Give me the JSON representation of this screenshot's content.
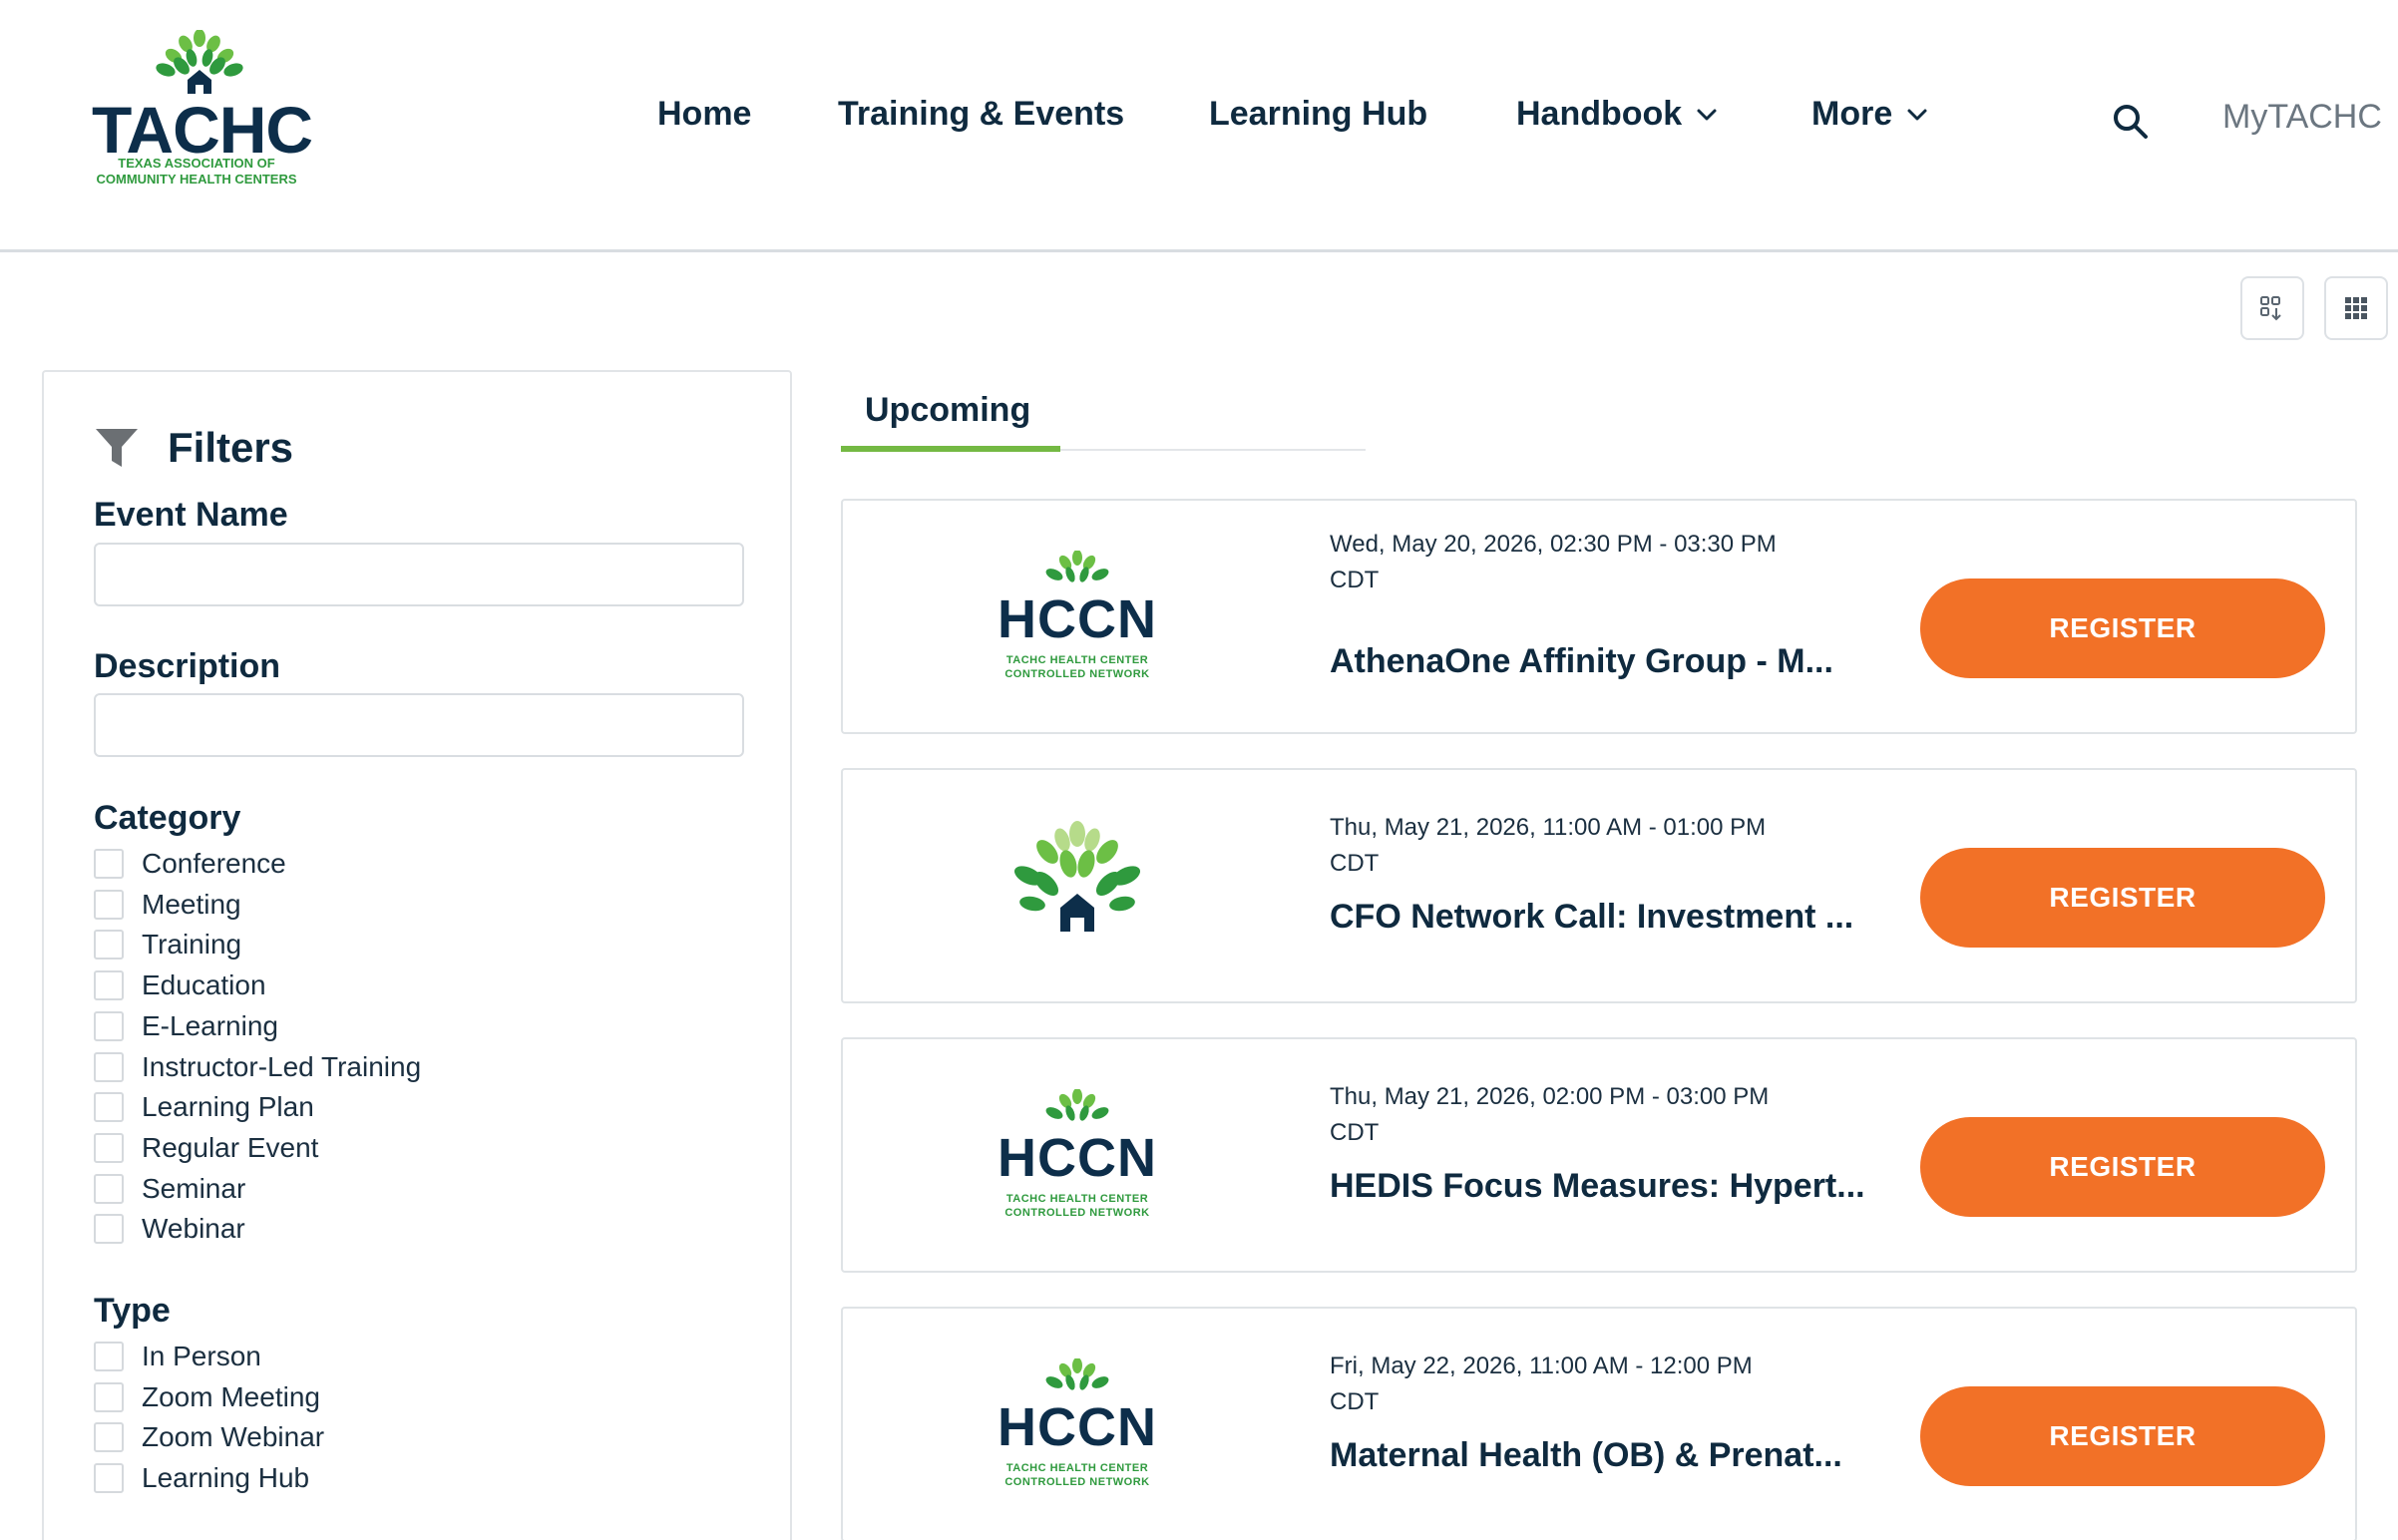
{
  "brand": {
    "name": "TACHC",
    "subtitle_line1": "TEXAS ASSOCIATION OF",
    "subtitle_line2": "COMMUNITY HEALTH CENTERS"
  },
  "nav": {
    "items": [
      {
        "label": "Home"
      },
      {
        "label": "Training & Events"
      },
      {
        "label": "Learning Hub"
      },
      {
        "label": "Handbook"
      },
      {
        "label": "More"
      }
    ],
    "account_label": "MyTACHC"
  },
  "filters": {
    "title": "Filters",
    "event_name_label": "Event Name",
    "description_label": "Description",
    "category_label": "Category",
    "categories": [
      "Conference",
      "Meeting",
      "Training",
      "Education",
      "E-Learning",
      "Instructor-Led Training",
      "Learning Plan",
      "Regular Event",
      "Seminar",
      "Webinar"
    ],
    "type_label": "Type",
    "types": [
      "In Person",
      "Zoom Meeting",
      "Zoom Webinar",
      "Learning Hub"
    ]
  },
  "tabs": {
    "upcoming": "Upcoming"
  },
  "events": [
    {
      "date": "Wed, May 20, 2026, 02:30 PM - 03:30 PM CDT",
      "title": "AthenaOne Affinity Group - M...",
      "logo": "hccn",
      "logo_text": "HCCN",
      "logo_sub1": "TACHC HEALTH CENTER",
      "logo_sub2": "CONTROLLED NETWORK",
      "button": "REGISTER"
    },
    {
      "date": "Thu, May 21, 2026, 11:00 AM - 01:00 PM CDT",
      "title": "CFO Network Call: Investment ...",
      "logo": "tree",
      "button": "REGISTER"
    },
    {
      "date": "Thu, May 21, 2026, 02:00 PM - 03:00 PM CDT",
      "title": "HEDIS Focus Measures: Hypert...",
      "logo": "hccn",
      "logo_text": "HCCN",
      "logo_sub1": "TACHC HEALTH CENTER",
      "logo_sub2": "CONTROLLED NETWORK",
      "button": "REGISTER"
    },
    {
      "date": "Fri, May 22, 2026, 11:00 AM - 12:00 PM CDT",
      "title": "Maternal Health (OB) & Prenat...",
      "logo": "hccn",
      "logo_text": "HCCN",
      "logo_sub1": "TACHC HEALTH CENTER",
      "logo_sub2": "CONTROLLED NETWORK",
      "button": "REGISTER"
    }
  ],
  "colors": {
    "navy": "#0f2a3f",
    "accent_orange": "#f27127",
    "accent_green": "#74b943",
    "leaf_green": "#2f9a3e"
  },
  "icons": {
    "search": "search-icon",
    "filter": "funnel-icon",
    "chevron": "chevron-down-icon",
    "view_compact": "grid-sort-icon",
    "view_grid": "grid-icon"
  }
}
